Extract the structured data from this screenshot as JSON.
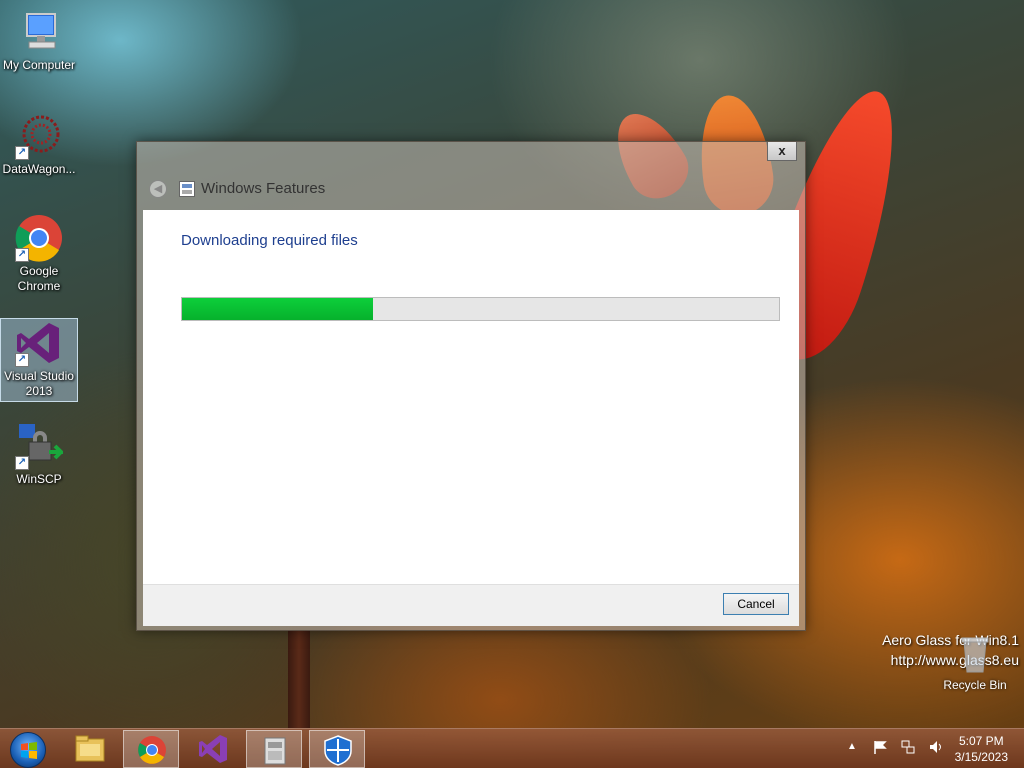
{
  "desktop": {
    "icons": [
      {
        "label": "My Computer",
        "icon": "computer-icon"
      },
      {
        "label": "DataWagon...",
        "icon": "datawagon-icon"
      },
      {
        "label": "Google Chrome",
        "icon": "chrome-icon"
      },
      {
        "label": "Visual Studio 2013",
        "icon": "visual-studio-icon"
      },
      {
        "label": "WinSCP",
        "icon": "winscp-icon"
      }
    ],
    "recycle_bin": "Recycle Bin",
    "watermark_line1": "Aero Glass for Win8.1",
    "watermark_line2": "http://www.glass8.eu"
  },
  "dialog": {
    "title": "Windows Features",
    "close_label": "x",
    "heading": "Downloading required files",
    "progress_fraction": 0.32,
    "cancel_label": "Cancel"
  },
  "taskbar": {
    "apps": [
      "file-explorer-icon",
      "chrome-icon",
      "visual-studio-icon",
      "installer-icon",
      "shield-icon"
    ],
    "clock_time": "5:07 PM",
    "clock_date": "3/15/2023"
  },
  "colors": {
    "progress_green": "#06b12c",
    "heading_blue": "#1e3f8f",
    "cancel_border": "#3c7fb1"
  }
}
